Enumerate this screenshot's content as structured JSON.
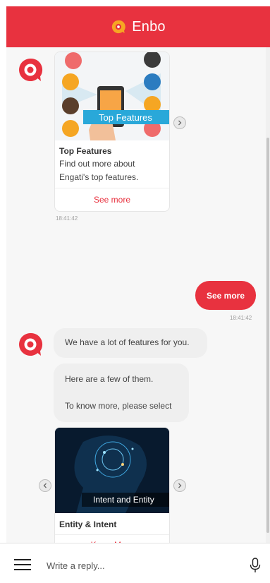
{
  "header": {
    "title": "Enbo",
    "brand_color": "#e8323f"
  },
  "messages": {
    "card1": {
      "banner": "Top Features",
      "title": "Top Features",
      "desc_line1": "Find out more about",
      "desc_line2": "Engati's top features.",
      "link": "See more",
      "time": "18:41:42"
    },
    "user_reply": {
      "text": "See more",
      "time": "18:41:42"
    },
    "bot1": {
      "text": "We have a lot of features for you."
    },
    "bot2": {
      "line1": "Here are a few of them.",
      "line2": "To know more, please select"
    },
    "card2": {
      "banner": "Intent and Entity",
      "title": "Entity & Intent",
      "link": "Know More"
    }
  },
  "composer": {
    "placeholder": "Write a reply..."
  }
}
